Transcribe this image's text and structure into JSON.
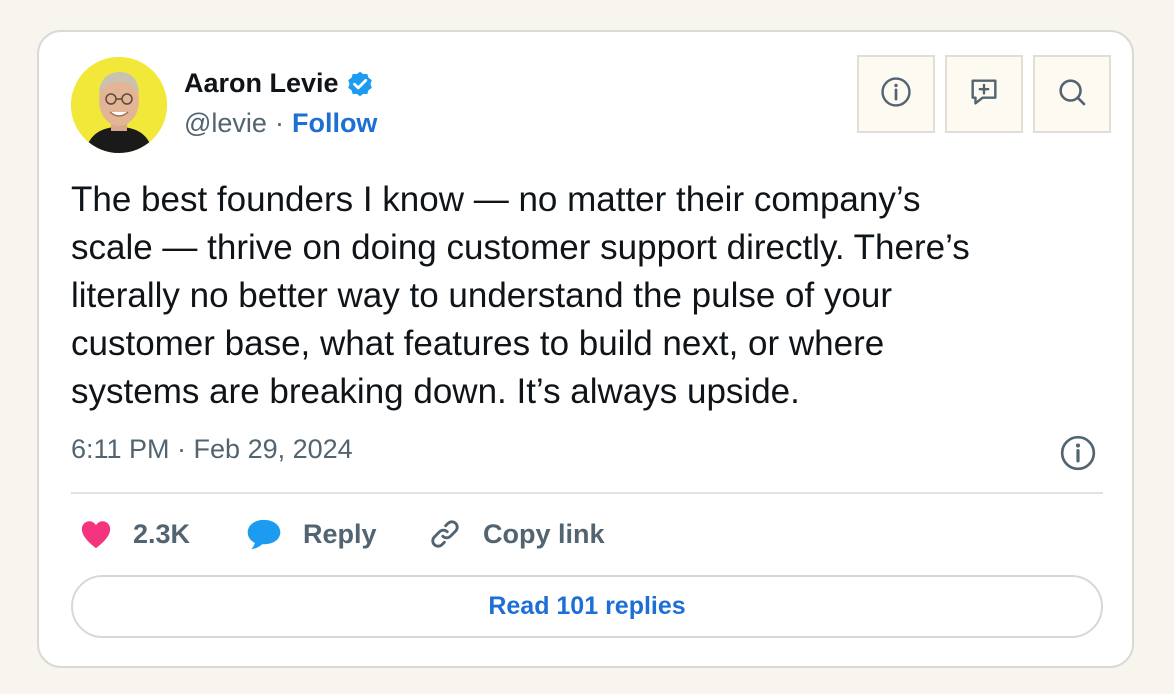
{
  "author": {
    "name": "Aaron Levie",
    "handle": "@levie",
    "separator": "·",
    "follow_label": "Follow",
    "verified": true
  },
  "toolbar": {
    "icons": [
      "info-icon",
      "add-comment-icon",
      "search-icon"
    ]
  },
  "tweet": {
    "text": "The best founders I know — no matter their company’s\nscale — thrive on doing customer support directly. There’s\nliterally no better way to understand the pulse of your\ncustomer base, what features to build next, or where\nsystems are breaking down. It’s always upside.",
    "timestamp": "6:11 PM · Feb 29, 2024"
  },
  "actions": {
    "likes": "2.3K",
    "reply_label": "Reply",
    "copy_link_label": "Copy link"
  },
  "read_replies_label": "Read 101 replies",
  "colors": {
    "link_blue": "#1d6fd6",
    "heart": "#f4347f",
    "reply_bubble": "#1d9bf0",
    "secondary_text": "#536471",
    "page_background": "#f8f5ee"
  }
}
